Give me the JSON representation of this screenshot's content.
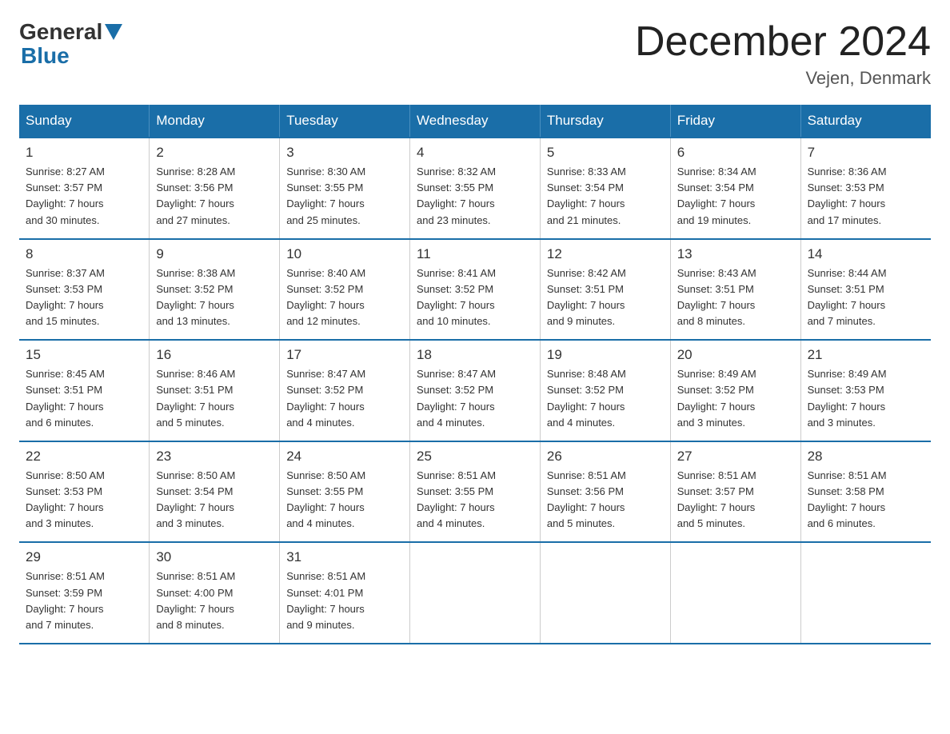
{
  "header": {
    "logo_general": "General",
    "logo_blue": "Blue",
    "month_title": "December 2024",
    "location": "Vejen, Denmark"
  },
  "days_of_week": [
    "Sunday",
    "Monday",
    "Tuesday",
    "Wednesday",
    "Thursday",
    "Friday",
    "Saturday"
  ],
  "weeks": [
    [
      {
        "day": "1",
        "sunrise": "8:27 AM",
        "sunset": "3:57 PM",
        "daylight": "7 hours and 30 minutes."
      },
      {
        "day": "2",
        "sunrise": "8:28 AM",
        "sunset": "3:56 PM",
        "daylight": "7 hours and 27 minutes."
      },
      {
        "day": "3",
        "sunrise": "8:30 AM",
        "sunset": "3:55 PM",
        "daylight": "7 hours and 25 minutes."
      },
      {
        "day": "4",
        "sunrise": "8:32 AM",
        "sunset": "3:55 PM",
        "daylight": "7 hours and 23 minutes."
      },
      {
        "day": "5",
        "sunrise": "8:33 AM",
        "sunset": "3:54 PM",
        "daylight": "7 hours and 21 minutes."
      },
      {
        "day": "6",
        "sunrise": "8:34 AM",
        "sunset": "3:54 PM",
        "daylight": "7 hours and 19 minutes."
      },
      {
        "day": "7",
        "sunrise": "8:36 AM",
        "sunset": "3:53 PM",
        "daylight": "7 hours and 17 minutes."
      }
    ],
    [
      {
        "day": "8",
        "sunrise": "8:37 AM",
        "sunset": "3:53 PM",
        "daylight": "7 hours and 15 minutes."
      },
      {
        "day": "9",
        "sunrise": "8:38 AM",
        "sunset": "3:52 PM",
        "daylight": "7 hours and 13 minutes."
      },
      {
        "day": "10",
        "sunrise": "8:40 AM",
        "sunset": "3:52 PM",
        "daylight": "7 hours and 12 minutes."
      },
      {
        "day": "11",
        "sunrise": "8:41 AM",
        "sunset": "3:52 PM",
        "daylight": "7 hours and 10 minutes."
      },
      {
        "day": "12",
        "sunrise": "8:42 AM",
        "sunset": "3:51 PM",
        "daylight": "7 hours and 9 minutes."
      },
      {
        "day": "13",
        "sunrise": "8:43 AM",
        "sunset": "3:51 PM",
        "daylight": "7 hours and 8 minutes."
      },
      {
        "day": "14",
        "sunrise": "8:44 AM",
        "sunset": "3:51 PM",
        "daylight": "7 hours and 7 minutes."
      }
    ],
    [
      {
        "day": "15",
        "sunrise": "8:45 AM",
        "sunset": "3:51 PM",
        "daylight": "7 hours and 6 minutes."
      },
      {
        "day": "16",
        "sunrise": "8:46 AM",
        "sunset": "3:51 PM",
        "daylight": "7 hours and 5 minutes."
      },
      {
        "day": "17",
        "sunrise": "8:47 AM",
        "sunset": "3:52 PM",
        "daylight": "7 hours and 4 minutes."
      },
      {
        "day": "18",
        "sunrise": "8:47 AM",
        "sunset": "3:52 PM",
        "daylight": "7 hours and 4 minutes."
      },
      {
        "day": "19",
        "sunrise": "8:48 AM",
        "sunset": "3:52 PM",
        "daylight": "7 hours and 4 minutes."
      },
      {
        "day": "20",
        "sunrise": "8:49 AM",
        "sunset": "3:52 PM",
        "daylight": "7 hours and 3 minutes."
      },
      {
        "day": "21",
        "sunrise": "8:49 AM",
        "sunset": "3:53 PM",
        "daylight": "7 hours and 3 minutes."
      }
    ],
    [
      {
        "day": "22",
        "sunrise": "8:50 AM",
        "sunset": "3:53 PM",
        "daylight": "7 hours and 3 minutes."
      },
      {
        "day": "23",
        "sunrise": "8:50 AM",
        "sunset": "3:54 PM",
        "daylight": "7 hours and 3 minutes."
      },
      {
        "day": "24",
        "sunrise": "8:50 AM",
        "sunset": "3:55 PM",
        "daylight": "7 hours and 4 minutes."
      },
      {
        "day": "25",
        "sunrise": "8:51 AM",
        "sunset": "3:55 PM",
        "daylight": "7 hours and 4 minutes."
      },
      {
        "day": "26",
        "sunrise": "8:51 AM",
        "sunset": "3:56 PM",
        "daylight": "7 hours and 5 minutes."
      },
      {
        "day": "27",
        "sunrise": "8:51 AM",
        "sunset": "3:57 PM",
        "daylight": "7 hours and 5 minutes."
      },
      {
        "day": "28",
        "sunrise": "8:51 AM",
        "sunset": "3:58 PM",
        "daylight": "7 hours and 6 minutes."
      }
    ],
    [
      {
        "day": "29",
        "sunrise": "8:51 AM",
        "sunset": "3:59 PM",
        "daylight": "7 hours and 7 minutes."
      },
      {
        "day": "30",
        "sunrise": "8:51 AM",
        "sunset": "4:00 PM",
        "daylight": "7 hours and 8 minutes."
      },
      {
        "day": "31",
        "sunrise": "8:51 AM",
        "sunset": "4:01 PM",
        "daylight": "7 hours and 9 minutes."
      },
      null,
      null,
      null,
      null
    ]
  ],
  "labels": {
    "sunrise": "Sunrise:",
    "sunset": "Sunset:",
    "daylight": "Daylight:"
  }
}
